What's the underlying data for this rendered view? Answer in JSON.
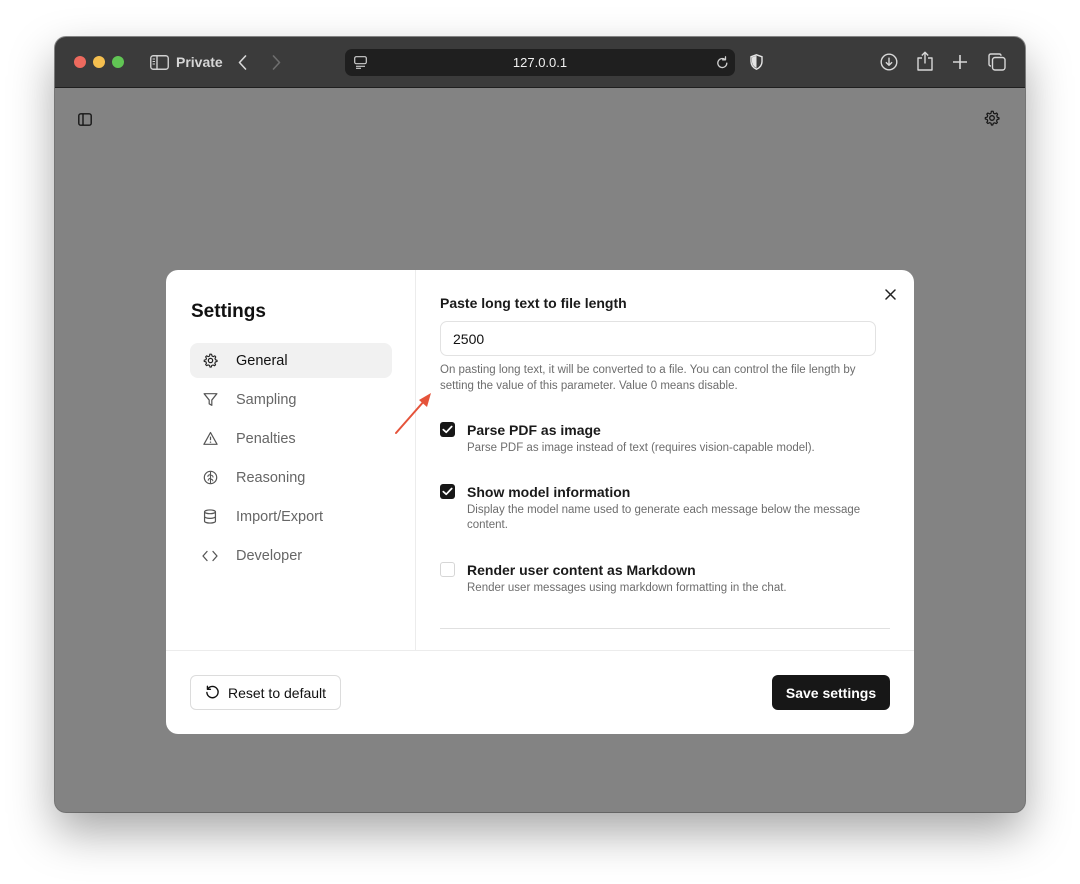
{
  "browser": {
    "mode_label": "Private",
    "url": "127.0.0.1"
  },
  "settings": {
    "title": "Settings",
    "nav": [
      {
        "label": "General",
        "icon": "gear-icon",
        "active": true
      },
      {
        "label": "Sampling",
        "icon": "funnel-icon",
        "active": false
      },
      {
        "label": "Penalties",
        "icon": "warning-triangle-icon",
        "active": false
      },
      {
        "label": "Reasoning",
        "icon": "brain-icon",
        "active": false
      },
      {
        "label": "Import/Export",
        "icon": "database-icon",
        "active": false
      },
      {
        "label": "Developer",
        "icon": "code-icon",
        "active": false
      }
    ],
    "paste_field": {
      "label": "Paste long text to file length",
      "value": "2500",
      "help": "On pasting long text, it will be converted to a file. You can control the file length by setting the value of this parameter. Value 0 means disable."
    },
    "options": [
      {
        "title": "Parse PDF as image",
        "description": "Parse PDF as image instead of text (requires vision-capable model).",
        "checked": true
      },
      {
        "title": "Show model information",
        "description": "Display the model name used to generate each message below the message content.",
        "checked": true
      },
      {
        "title": "Render user content as Markdown",
        "description": "Render user messages using markdown formatting in the chat.",
        "checked": false
      }
    ],
    "footer": {
      "reset_label": "Reset to default",
      "save_label": "Save settings"
    }
  },
  "colors": {
    "annotation_arrow": "#e5533a",
    "primary_button": "#171717",
    "overlay": "#838383"
  }
}
